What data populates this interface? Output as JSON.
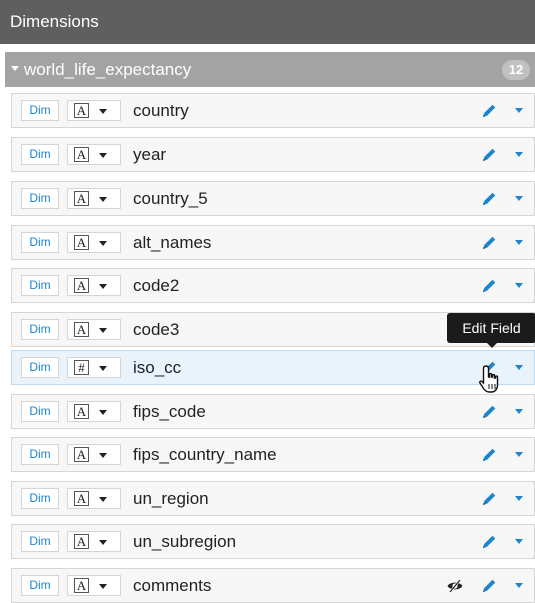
{
  "panel": {
    "title": "Dimensions"
  },
  "dataset": {
    "name": "world_life_expectancy",
    "count": "12"
  },
  "tooltip": {
    "text": "Edit Field"
  },
  "colors": {
    "accent": "#1d85d0",
    "header": "#5f5f5f",
    "dataset_bar": "#a3a3a3"
  },
  "rows": [
    {
      "dim_label": "Dim",
      "type_icon": "A",
      "field": "country"
    },
    {
      "dim_label": "Dim",
      "type_icon": "A",
      "field": "year"
    },
    {
      "dim_label": "Dim",
      "type_icon": "A",
      "field": "country_5"
    },
    {
      "dim_label": "Dim",
      "type_icon": "A",
      "field": "alt_names"
    },
    {
      "dim_label": "Dim",
      "type_icon": "A",
      "field": "code2"
    },
    {
      "dim_label": "Dim",
      "type_icon": "A",
      "field": "code3"
    },
    {
      "dim_label": "Dim",
      "type_icon": "#",
      "field": "iso_cc"
    },
    {
      "dim_label": "Dim",
      "type_icon": "A",
      "field": "fips_code"
    },
    {
      "dim_label": "Dim",
      "type_icon": "A",
      "field": "fips_country_name"
    },
    {
      "dim_label": "Dim",
      "type_icon": "A",
      "field": "un_region"
    },
    {
      "dim_label": "Dim",
      "type_icon": "A",
      "field": "un_subregion"
    },
    {
      "dim_label": "Dim",
      "type_icon": "A",
      "field": "comments"
    }
  ]
}
